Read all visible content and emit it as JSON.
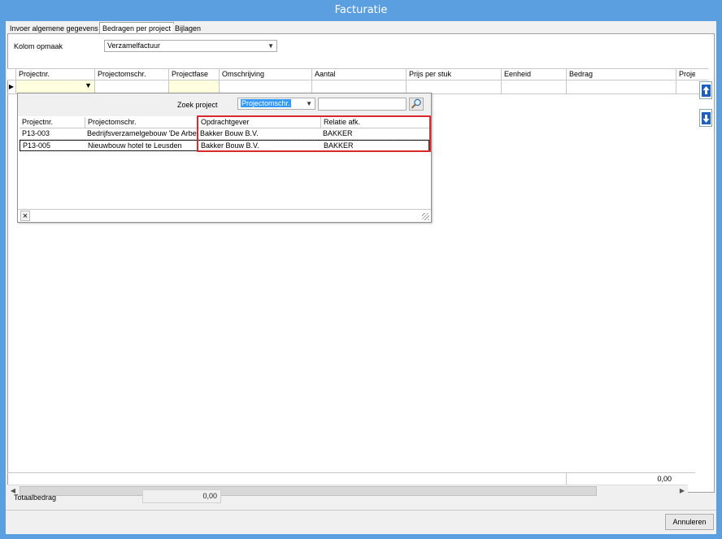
{
  "window": {
    "title": "Facturatie"
  },
  "tabs": [
    {
      "label": "Invoer algemene gegevens"
    },
    {
      "label": "Bedragen per project"
    },
    {
      "label": "Bijlagen"
    }
  ],
  "kolom_opmaak": {
    "label": "Kolom opmaak",
    "value": "Verzamelfactuur"
  },
  "grid": {
    "columns": [
      "Projectnr.",
      "Projectomschr.",
      "Projectfase",
      "Omschrijving",
      "Aantal",
      "Prijs per stuk",
      "Eenheid",
      "Bedrag",
      "Proje"
    ],
    "total": "0,00"
  },
  "popup": {
    "search_label": "Zoek project",
    "search_field": "Projectomschr.",
    "search_value": "",
    "columns": [
      "Projectnr.",
      "Projectomschr.",
      "Opdrachtgever",
      "Relatie afk."
    ],
    "rows": [
      {
        "projectnr": "P13-003",
        "omschr": "Bedrijfsverzamelgebouw 'De Arbeid'",
        "opdrachtgever": "Bakker Bouw B.V.",
        "relatie": "BAKKER"
      },
      {
        "projectnr": "P13-005",
        "omschr": "Nieuwbouw hotel te Leusden",
        "opdrachtgever": "Bakker Bouw B.V.",
        "relatie": "BAKKER"
      }
    ],
    "close_glyph": "×"
  },
  "footer": {
    "totaal_label": "Totaalbedrag",
    "totaal_value": "0,00",
    "cancel_label": "Annuleren"
  },
  "colors": {
    "title_bar": "#5b9fe0",
    "highlight": "#d9282f",
    "selection": "#3399ff",
    "edit_cell": "#ffffe0"
  }
}
